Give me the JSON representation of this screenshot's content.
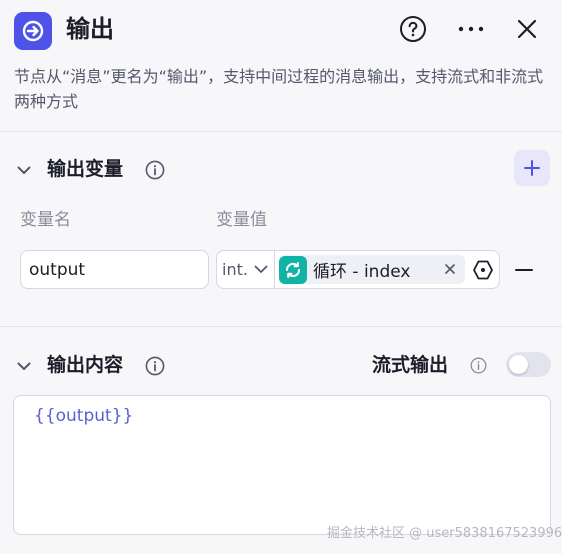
{
  "header": {
    "title": "输出",
    "icons": {
      "node": "arrow-right-circle-icon",
      "help": "question-circle-icon",
      "more": "more-horizontal-icon",
      "close": "close-icon"
    },
    "description": "节点从“消息”更名为“输出”，支持中间过程的消息输出，支持流式和非流式两种方式"
  },
  "output_variables": {
    "title": "输出变量",
    "col_name": "变量名",
    "col_value": "变量值",
    "rows": [
      {
        "name": "output",
        "type": "int.",
        "ref_label": "循环 - index"
      }
    ]
  },
  "output_content": {
    "title": "输出内容",
    "stream_label": "流式输出",
    "stream_enabled": false,
    "content": "{{output}}"
  },
  "watermark": "掘金技术社区 @ user5838167523996",
  "colors": {
    "accent": "#4d53e8",
    "loop_badge": "#11b3a5",
    "template_text": "#5a5fd6"
  }
}
